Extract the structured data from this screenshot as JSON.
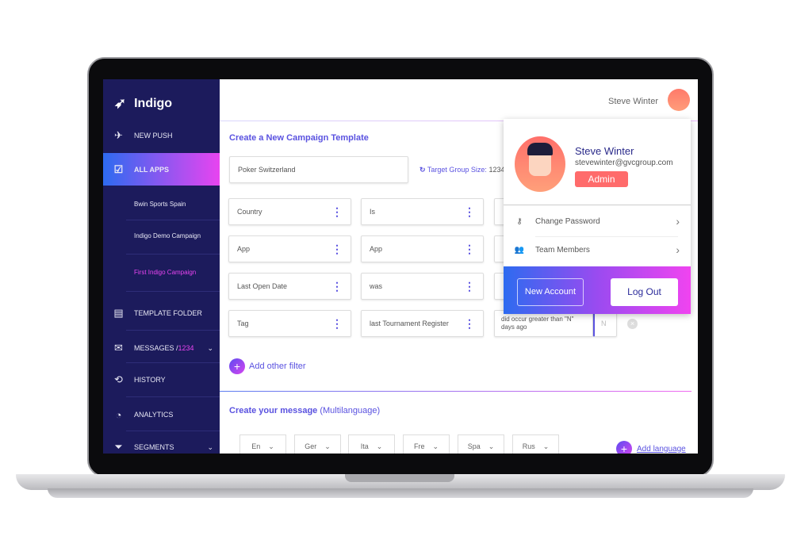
{
  "app": {
    "name": "Indigo"
  },
  "sidebar": {
    "items": [
      {
        "label": "NEW PUSH",
        "icon": "paper-plane-icon"
      },
      {
        "label": "ALL APPS",
        "icon": "edit-icon"
      },
      {
        "label": "TEMPLATE FOLDER",
        "icon": "layout-icon"
      },
      {
        "label": "MESSAGES / ",
        "count": "1234",
        "icon": "mail-icon"
      },
      {
        "label": "HISTORY",
        "icon": "history-icon"
      },
      {
        "label": "ANALYTICS",
        "icon": "pie-chart-icon"
      },
      {
        "label": "SEGMENTS",
        "icon": "filter-icon"
      }
    ],
    "sub_items": [
      "Bwin Sports Spain",
      "Indigo Demo Campaign",
      "First Indigo Campaign"
    ]
  },
  "header": {
    "user_name": "Steve Winter"
  },
  "campaign": {
    "title": "Create a New Campaign Template",
    "name_value": "Poker Switzerland",
    "target_label": "Target Group Size:",
    "target_value": "1234",
    "filters": [
      [
        "Country",
        "Is"
      ],
      [
        "App",
        "App"
      ],
      [
        "Last Open Date",
        "was"
      ],
      [
        "Tag",
        "last Tournament Register"
      ]
    ],
    "last_condition": "did occur greater than \"N\" days ago",
    "n_placeholder": "N",
    "add_filter": "Add other filter"
  },
  "message": {
    "title": "Create your message",
    "subtitle": "(Multilanguage)",
    "languages": [
      "En",
      "Ger",
      "Ita",
      "Fre",
      "Spa",
      "Rus"
    ],
    "add_language": "Add language"
  },
  "popup": {
    "name": "Steve Winter",
    "email": "stevewinter@gvcgroup.com",
    "role": "Admin",
    "items": [
      "Change Password",
      "Team Members"
    ],
    "new_account": "New Account",
    "logout": "Log Out"
  },
  "colors": {
    "sidebar": "#1c1b5c",
    "accent": "#5a52e0",
    "pink": "#e844f0",
    "admin": "#ff6b6b"
  }
}
